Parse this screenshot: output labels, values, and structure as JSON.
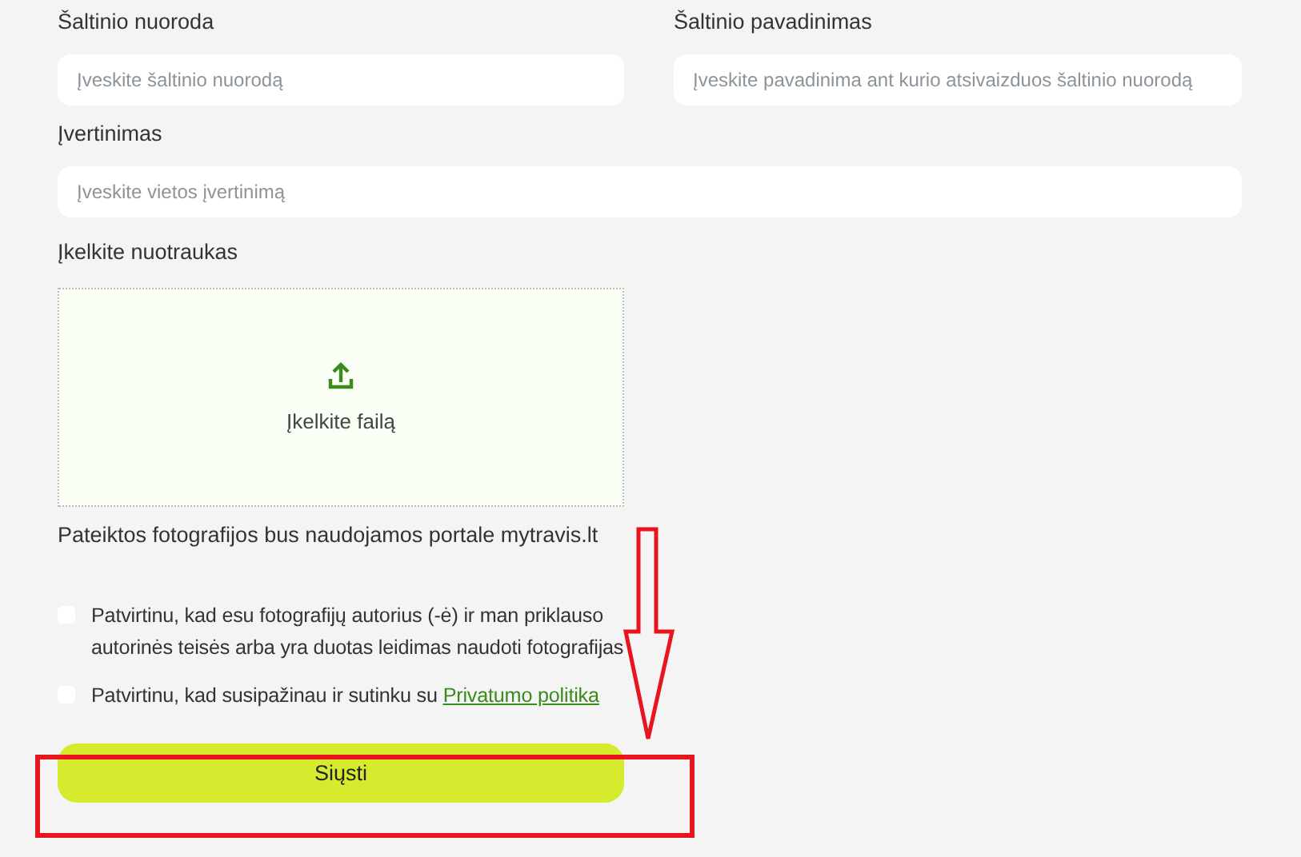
{
  "fields": [
    {
      "label": "Šaltinio nuoroda",
      "placeholder": "Įveskite šaltinio nuorodą",
      "wide": false
    },
    {
      "label": "Šaltinio pavadinimas",
      "placeholder": "Įveskite pavadinima ant kurio atsivaizduos šaltinio nuorodą",
      "wide": false
    },
    {
      "label": "Įvertinimas",
      "placeholder": "Įveskite vietos įvertinimą",
      "wide": true
    }
  ],
  "upload": {
    "label": "Įkelkite nuotraukas",
    "button": "Įkelkite failą"
  },
  "note": "Pateiktos fotografijos bus naudojamos portale mytravis.lt",
  "checkboxes": [
    {
      "text": "Patvirtinu, kad esu fotografijų autorius (-ė) ir man priklauso autorinės teisės arba yra duotas leidimas naudoti fotografijas",
      "checked": false
    },
    {
      "text": "Patvirtinu, kad susipažinau ir sutinku su",
      "link": "Privatumo politika",
      "checked": false
    }
  ],
  "submit": "Siųsti"
}
